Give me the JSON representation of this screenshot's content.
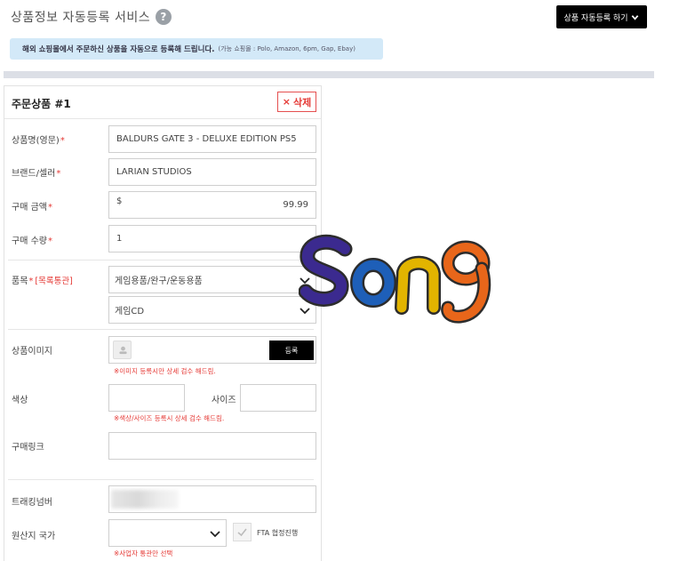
{
  "header": {
    "title": "상품정보 자동등록 서비스",
    "help_symbol": "?",
    "auto_button_label": "상품 자동등록 하기"
  },
  "notice": {
    "text": "해외 쇼핑몰에서 주문하신 상품을 자동으로 등록해 드립니다.",
    "sub": "(가능 쇼핑몰 : Polo, Amazon, 6pm, Gap, Ebay)"
  },
  "item": {
    "title": "주문상품 #1",
    "delete_label": "삭제",
    "delete_symbol": "×",
    "fields": {
      "name": {
        "label": "상품명(영문)",
        "value": "BALDURS GATE 3 - DELUXE EDITION PS5"
      },
      "brand": {
        "label": "브랜드/셀러",
        "value": "LARIAN STUDIOS"
      },
      "price": {
        "label": "구매 금액",
        "currency": "$",
        "value": "99.99"
      },
      "qty": {
        "label": "구매 수량",
        "value": "1"
      },
      "category": {
        "label": "품목",
        "customs": "[목록통관]",
        "main": "게임용품/완구/운동용품",
        "sub": "게임CD"
      },
      "image": {
        "label": "상품이미지",
        "upload_label": "등록",
        "hint": "※이미지 등록시만 상세 검수 해드림."
      },
      "color": {
        "label": "색상"
      },
      "size": {
        "label": "사이즈"
      },
      "color_size_hint": "※색상/사이즈 등록시 상세 검수 해드림.",
      "link": {
        "label": "구매링크"
      },
      "tracking": {
        "label": "트래킹넘버"
      },
      "country": {
        "label": "원산지 국가",
        "fta_label": "FTA 협정진행",
        "hint": "※사업자 통관만 선택"
      },
      "required_mark": "*"
    }
  },
  "overlay": {
    "logo_text": "Song",
    "colors": {
      "S": "#3b2a8f",
      "o": "#1e5fb8",
      "n": "#e2b400",
      "g": "#e8661a",
      "outline": "#2c2c2c"
    }
  },
  "colors": {
    "accent": "#e53935",
    "notice_bg": "#d3e9f8",
    "button_bg": "#000000"
  }
}
